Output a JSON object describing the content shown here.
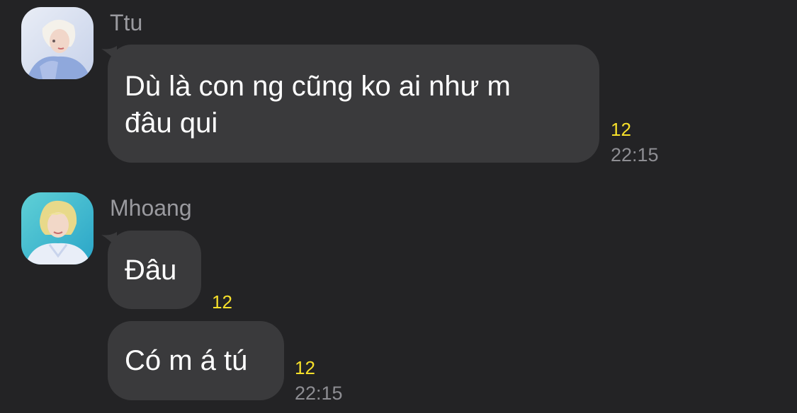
{
  "messages": [
    {
      "sender": "Ttu",
      "avatar_icon": "user-avatar-photo",
      "bubbles": [
        {
          "text": "Dù là con ng cũng ko ai như m\nđâu qui",
          "unread_count": "12",
          "time": "22:15"
        }
      ]
    },
    {
      "sender": "Mhoang",
      "avatar_icon": "user-avatar-photo",
      "bubbles": [
        {
          "text": "Đâu",
          "unread_count": "12",
          "time": ""
        },
        {
          "text": "Có m á tú",
          "unread_count": "12",
          "time": "22:15"
        }
      ]
    }
  ],
  "colors": {
    "background": "#232325",
    "bubble": "#3a3a3c",
    "unread_count": "#f7e02a",
    "meta_text": "#8e8e93"
  }
}
